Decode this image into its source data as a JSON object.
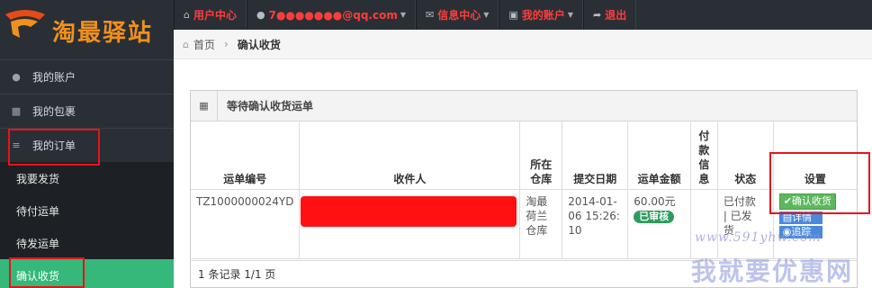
{
  "brand": {
    "name": "淘最驿站",
    "accent": "#f0901e"
  },
  "topnav": [
    {
      "icon": "home-icon",
      "label": "用户中心",
      "caret": false,
      "color": "red"
    },
    {
      "icon": "user-icon",
      "label": "7●●●●●●●@qq.com",
      "caret": true,
      "color": "red"
    },
    {
      "icon": "mail-icon",
      "label": "信息中心",
      "caret": true,
      "color": "red"
    },
    {
      "icon": "account-icon",
      "label": "我的账户",
      "caret": true,
      "color": "red"
    },
    {
      "icon": "logout-icon",
      "label": "退出",
      "caret": false,
      "color": "red"
    }
  ],
  "breadcrumb": {
    "home": "首页",
    "current": "确认收货"
  },
  "sidebar": {
    "items": [
      {
        "icon": "user-icon",
        "label": "我的账户"
      },
      {
        "icon": "briefcase-icon",
        "label": "我的包裹"
      },
      {
        "icon": "list-icon",
        "label": "我的订单"
      }
    ],
    "submenu": [
      {
        "label": "我要发货",
        "active": false
      },
      {
        "label": "待付运单",
        "active": false
      },
      {
        "label": "待发运单",
        "active": false
      },
      {
        "label": "确认收货",
        "active": true
      }
    ]
  },
  "panel": {
    "title": "等待确认收货运单",
    "columns": [
      "运单编号",
      "收件人",
      "所在仓库",
      "提交日期",
      "运单金额",
      "付款信息",
      "状态",
      "设置"
    ],
    "rows": [
      {
        "order_no": "TZ1000000024YD",
        "recipient": "",
        "warehouse": "淘最荷兰仓库",
        "date": "2014-01-06 15:26:10",
        "amount": "60.00元",
        "audit_badge": "已审核",
        "payment": "",
        "status": "已付款 | 已发货",
        "actions": {
          "confirm": "确认收货",
          "detail": "详情",
          "track": "追踪"
        }
      }
    ],
    "footer": "1 条记录 1/1 页"
  },
  "watermark": {
    "url": "www.591yhw.com",
    "text": "我就要优惠网"
  }
}
